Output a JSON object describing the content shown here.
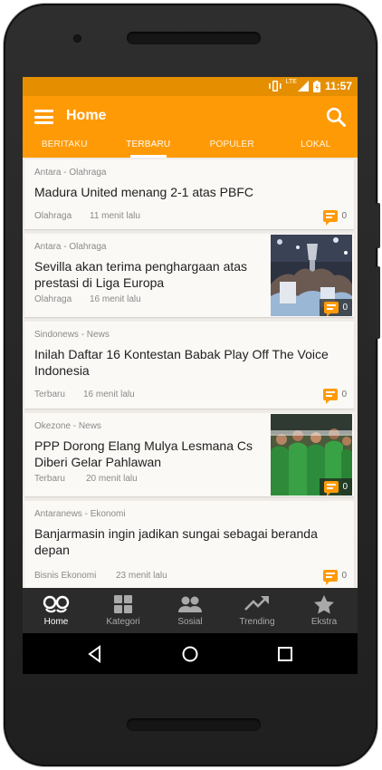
{
  "status_bar": {
    "network": "LTE",
    "time": "11:57"
  },
  "app_bar": {
    "title": "Home"
  },
  "tabs": [
    {
      "label": "BERITAKU",
      "active": false
    },
    {
      "label": "TERBARU",
      "active": true
    },
    {
      "label": "POPULER",
      "active": false
    },
    {
      "label": "LOKAL",
      "active": false
    }
  ],
  "articles": [
    {
      "source": "Antara - Olahraga",
      "title": "Madura United menang 2-1 atas PBFC",
      "category": "Olahraga",
      "time": "11 menit lalu",
      "comments": "0",
      "has_image": false
    },
    {
      "source": "Antara - Olahraga",
      "title": "Sevilla akan terima penghargaan atas prestasi di Liga Europa",
      "category": "Olahraga",
      "time": "16 menit lalu",
      "comments": "0",
      "has_image": true
    },
    {
      "source": "Sindonews - News",
      "title": "Inilah Daftar 16 Kontestan Babak Play Off The Voice Indonesia",
      "category": "Terbaru",
      "time": "16 menit lalu",
      "comments": "0",
      "has_image": false
    },
    {
      "source": "Okezone - News",
      "title": "PPP Dorong Elang Mulya Lesmana Cs Diberi Gelar Pahlawan",
      "category": "Terbaru",
      "time": "20 menit lalu",
      "comments": "0",
      "has_image": true
    },
    {
      "source": "Antaranews - Ekonomi",
      "title": "Banjarmasin ingin jadikan sungai sebagai beranda depan",
      "category": "Bisnis Ekonomi",
      "time": "23 menit lalu",
      "comments": "0",
      "has_image": false
    }
  ],
  "bottom_nav": [
    {
      "label": "Home",
      "icon": "glasses-icon",
      "active": true
    },
    {
      "label": "Kategori",
      "icon": "grid-icon",
      "active": false
    },
    {
      "label": "Sosial",
      "icon": "people-icon",
      "active": false
    },
    {
      "label": "Trending",
      "icon": "trending-up-icon",
      "active": false
    },
    {
      "label": "Ekstra",
      "icon": "star-icon",
      "active": false
    }
  ],
  "colors": {
    "accent": "#ff9a07",
    "status": "#e58f00",
    "nav": "#2b2b2b",
    "card": "#fbf9f6"
  }
}
